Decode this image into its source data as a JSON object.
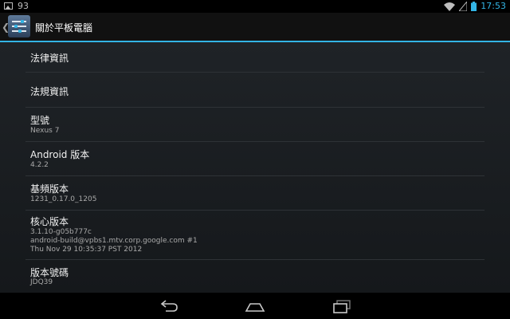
{
  "status_bar": {
    "notification_count": "93",
    "time": "17:53",
    "icons": [
      "gallery-icon",
      "wifi-icon",
      "signal-icon",
      "battery-icon"
    ],
    "time_color": "#33b5e5"
  },
  "action_bar": {
    "title": "關於平板電腦",
    "accent_color": "#33b5e5"
  },
  "items": [
    {
      "title": "法律資訊"
    },
    {
      "title": "法規資訊"
    },
    {
      "title": "型號",
      "summary": "Nexus 7"
    },
    {
      "title": "Android 版本",
      "summary": "4.2.2"
    },
    {
      "title": "基頻版本",
      "summary": "1231_0.17.0_1205"
    },
    {
      "title": "核心版本",
      "summary_lines": [
        "3.1.10-g05b777c",
        "android-build@vpbs1.mtv.corp.google.com #1",
        "Thu Nov 29 10:35:37 PST 2012"
      ]
    },
    {
      "title": "版本號碼",
      "summary": "JDQ39"
    }
  ],
  "nav_bar": {
    "buttons": [
      "back-icon",
      "home-icon",
      "recent-apps-icon"
    ]
  }
}
